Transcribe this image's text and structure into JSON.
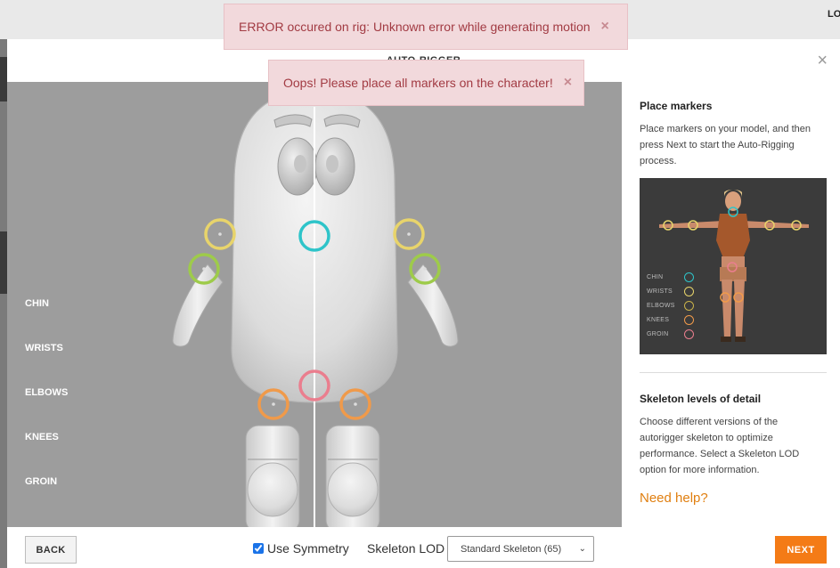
{
  "backdrop": {
    "corner_text": "LO"
  },
  "modal": {
    "title": "AUTO-RIGGER",
    "close_glyph": "×"
  },
  "markers": {
    "labels": [
      "CHIN",
      "WRISTS",
      "ELBOWS",
      "KNEES",
      "GROIN"
    ],
    "colors": {
      "chin": "#2ec4c9",
      "wrists": "#e8d46b",
      "elbows": "#9ecb4a",
      "knees": "#f09a4a",
      "groin": "#ea7e8e"
    }
  },
  "sidepanel": {
    "place_heading": "Place markers",
    "place_text": "Place markers on your model, and then press Next to start the Auto-Rigging process.",
    "preview_legend": [
      "CHIN",
      "WRISTS",
      "ELBOWS",
      "KNEES",
      "GROIN"
    ],
    "lod_heading": "Skeleton levels of detail",
    "lod_text": "Choose different versions of the autorigger skeleton to optimize performance. Select a Skeleton LOD option for more information.",
    "help_link": "Need help?"
  },
  "footer": {
    "back_label": "BACK",
    "symmetry_label": "Use Symmetry",
    "symmetry_checked": true,
    "lod_label": "Skeleton LOD",
    "lod_selected": "Standard Skeleton (65)",
    "next_label": "NEXT"
  },
  "toasts": [
    {
      "message": "ERROR occured on rig: Unknown error while generating motion",
      "close_glyph": "×"
    },
    {
      "message": "Oops! Please place all markers on the character!",
      "close_glyph": "×"
    }
  ],
  "colors": {
    "accent": "#f47b16",
    "error_bg": "#f2d9dc",
    "error_text": "#a23b43"
  }
}
